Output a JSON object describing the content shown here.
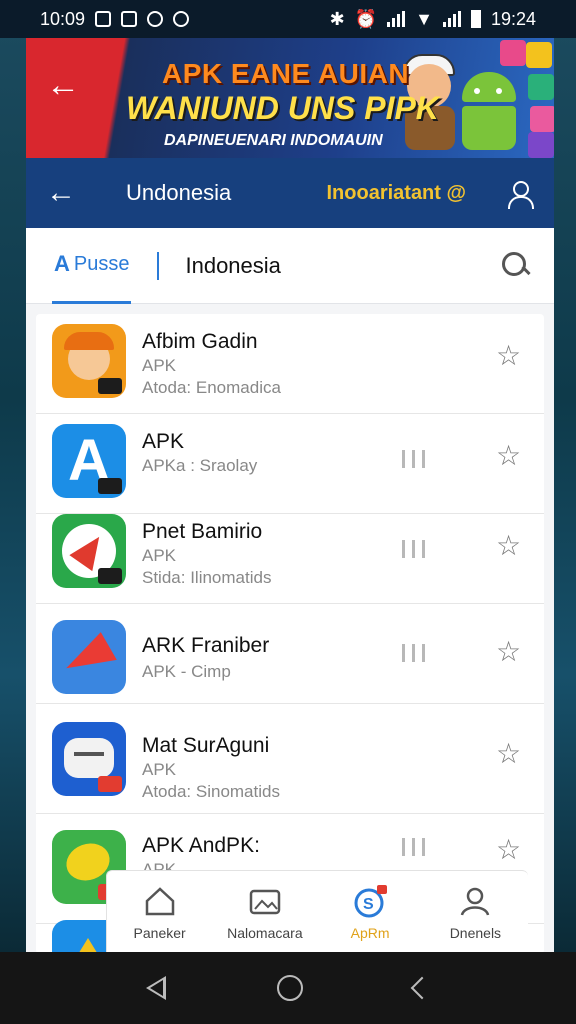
{
  "status_bar": {
    "time_left": "10:09",
    "time_right": "19:24"
  },
  "banner": {
    "line1": "APK EANE AUIAN",
    "line2": "WANIUND UNS PIPK",
    "line3": "DAPINEUENARI INDOMAUIN"
  },
  "header": {
    "title": "Undonesia",
    "tag": "Inooariatant @"
  },
  "search": {
    "tab_label": "Pusse",
    "query": "Indonesia"
  },
  "apps": [
    {
      "name": "Afbim Gadin",
      "sub1": "APK",
      "sub2": "Atoda: Enomadica",
      "icon": "cartoon-kid-icon",
      "color": "#f29a1a",
      "bars": false
    },
    {
      "name": "APK",
      "sub1": "APKa : Sraolay",
      "sub2": "",
      "icon": "letter-a-icon",
      "color": "#1c8ee6",
      "bars": true
    },
    {
      "name": "Pnet Bamirio",
      "sub1": "APK",
      "sub2": "Stida: Ilinomatids",
      "icon": "compass-icon",
      "color": "#2aa84a",
      "bars": true
    },
    {
      "name": "ARK Franiber",
      "sub1": "APK - Cimp",
      "sub2": "",
      "icon": "paper-plane-icon",
      "color": "#3a86e0",
      "bars": true
    },
    {
      "name": "Mat SurAguni",
      "sub1": "APK",
      "sub2": "Atoda: Sinomatids",
      "icon": "chat-bot-icon",
      "color": "#1e5fd0",
      "bars": false
    },
    {
      "name": "APK AndPK:",
      "sub1": "APK",
      "sub2": "",
      "icon": "banana-icon",
      "color": "#3db14a",
      "bars": true
    }
  ],
  "bottom_nav": [
    {
      "label": "Paneker",
      "icon": "home-icon"
    },
    {
      "label": "Nalomacara",
      "icon": "gallery-icon"
    },
    {
      "label": "ApRm",
      "icon": "apk-store-icon"
    },
    {
      "label": "Dnenels",
      "icon": "profile-icon"
    }
  ],
  "colors": {
    "header_blue": "#17407e",
    "accent_blue": "#2a7bd8",
    "tag_yellow": "#f2c230",
    "active_orange": "#e0a21a"
  }
}
